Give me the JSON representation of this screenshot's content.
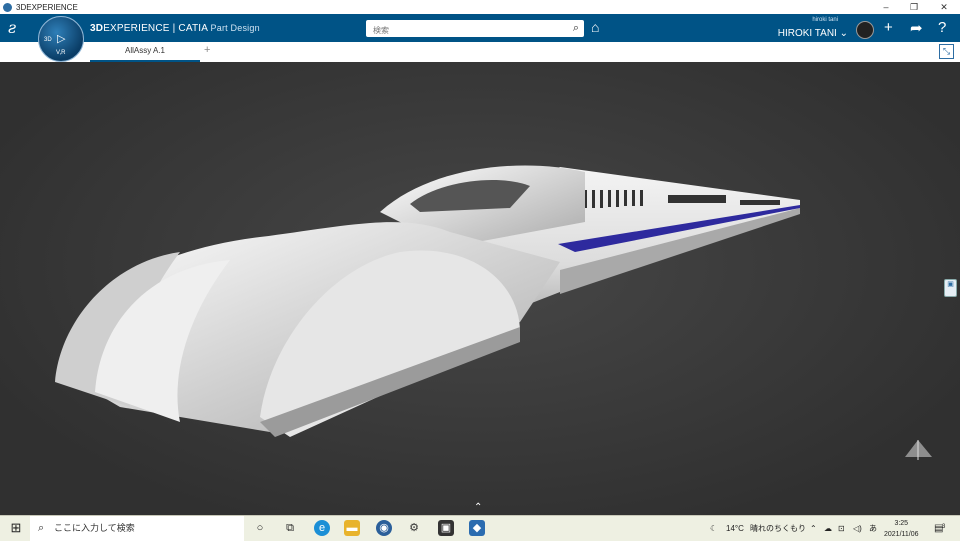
{
  "window": {
    "title": "3DEXPERIENCE",
    "controls": [
      "–",
      "❐",
      "✕"
    ]
  },
  "topbar": {
    "brand_prefix": "3D",
    "brand_main": "EXPERIENCE | CATIA",
    "brand_app": "Part Design",
    "compass": {
      "label_3d": "3D",
      "label_v": "V,R"
    },
    "search_placeholder": "検索",
    "user_login": "hiroki tani",
    "user_name": "HIROKI TANI ⌄",
    "icons": [
      "tag-icon",
      "add-icon",
      "share-icon",
      "help-icon"
    ]
  },
  "tabs": [
    {
      "label": "AllAssy A.1"
    }
  ],
  "tab_add": "+",
  "taskbar": {
    "search_text": "ここに入力して検索",
    "weather_temp": "14°C",
    "weather_desc": "晴れのちくもり",
    "ime": "あ",
    "time": "3:25",
    "date": "2021/11/06",
    "notifications": "3"
  },
  "colors": {
    "topbar": "#005386",
    "viewport": "#3a3a3a",
    "accent_stripe": "#2e2a9e"
  }
}
